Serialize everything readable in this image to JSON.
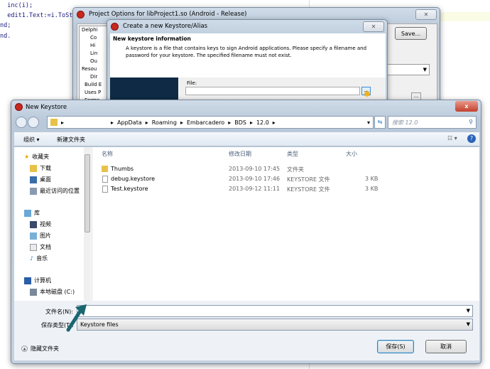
{
  "editor": {
    "lines": [
      "  inc(i);",
      "  edit1.Text:=i.ToSt",
      "nd;",
      "",
      "nd."
    ]
  },
  "project_options": {
    "title": "Project Options for libProject1.so  (Android - Release)",
    "close": "✕",
    "save_button": "Save...",
    "tree": [
      "Delphi",
      "Co",
      "Hi",
      "Lin",
      "Ou",
      "Resou",
      "Dir",
      "Build E",
      "Uses P",
      "Forms"
    ]
  },
  "keystore_wizard": {
    "title": "Create a new Keystore/Alias",
    "close": "✕",
    "header": "New keystore information",
    "description": "A keystore is a file that contains keys to sign Android applications. Please specify a filename and password for your keystore. The specified filename must not exist.",
    "file_label": "File:",
    "browse_button": "..."
  },
  "save_dialog": {
    "title": "New Keystore",
    "close": "x",
    "breadcrumb": [
      "AppData",
      "Roaming",
      "Embarcadero",
      "BDS",
      "12.0"
    ],
    "search_placeholder": "搜索 12.0",
    "toolbar": {
      "organize": "组织 ▾",
      "new_folder": "新建文件夹"
    },
    "nav": {
      "favorites": "收藏夹",
      "items_fav": [
        "下载",
        "桌面",
        "最近访问的位置"
      ],
      "libraries": "库",
      "items_lib": [
        "视频",
        "图片",
        "文档",
        "音乐"
      ],
      "computer": "计算机",
      "items_comp": [
        "本地磁盘 (C:)"
      ]
    },
    "columns": [
      "名称",
      "修改日期",
      "类型",
      "大小"
    ],
    "files": [
      {
        "name": "Thumbs",
        "date": "2013-09-10 17:45",
        "type": "文件夹",
        "size": "",
        "icon": "folder"
      },
      {
        "name": "debug.keystore",
        "date": "2013-09-10 17:46",
        "type": "KEYSTORE 文件",
        "size": "3 KB",
        "icon": "file"
      },
      {
        "name": "Test.keystore",
        "date": "2013-09-12 11:11",
        "type": "KEYSTORE 文件",
        "size": "3 KB",
        "icon": "file"
      }
    ],
    "filename_label": "文件名(N):",
    "filename_value": "",
    "filetype_label": "保存类型(T):",
    "filetype_value": "Keystore files",
    "hide_folders": "隐藏文件夹",
    "save_button": "保存(S)",
    "cancel_button": "取消"
  },
  "colors": {
    "accent": "#1a6670",
    "titlebar": "#c4d2e0"
  }
}
